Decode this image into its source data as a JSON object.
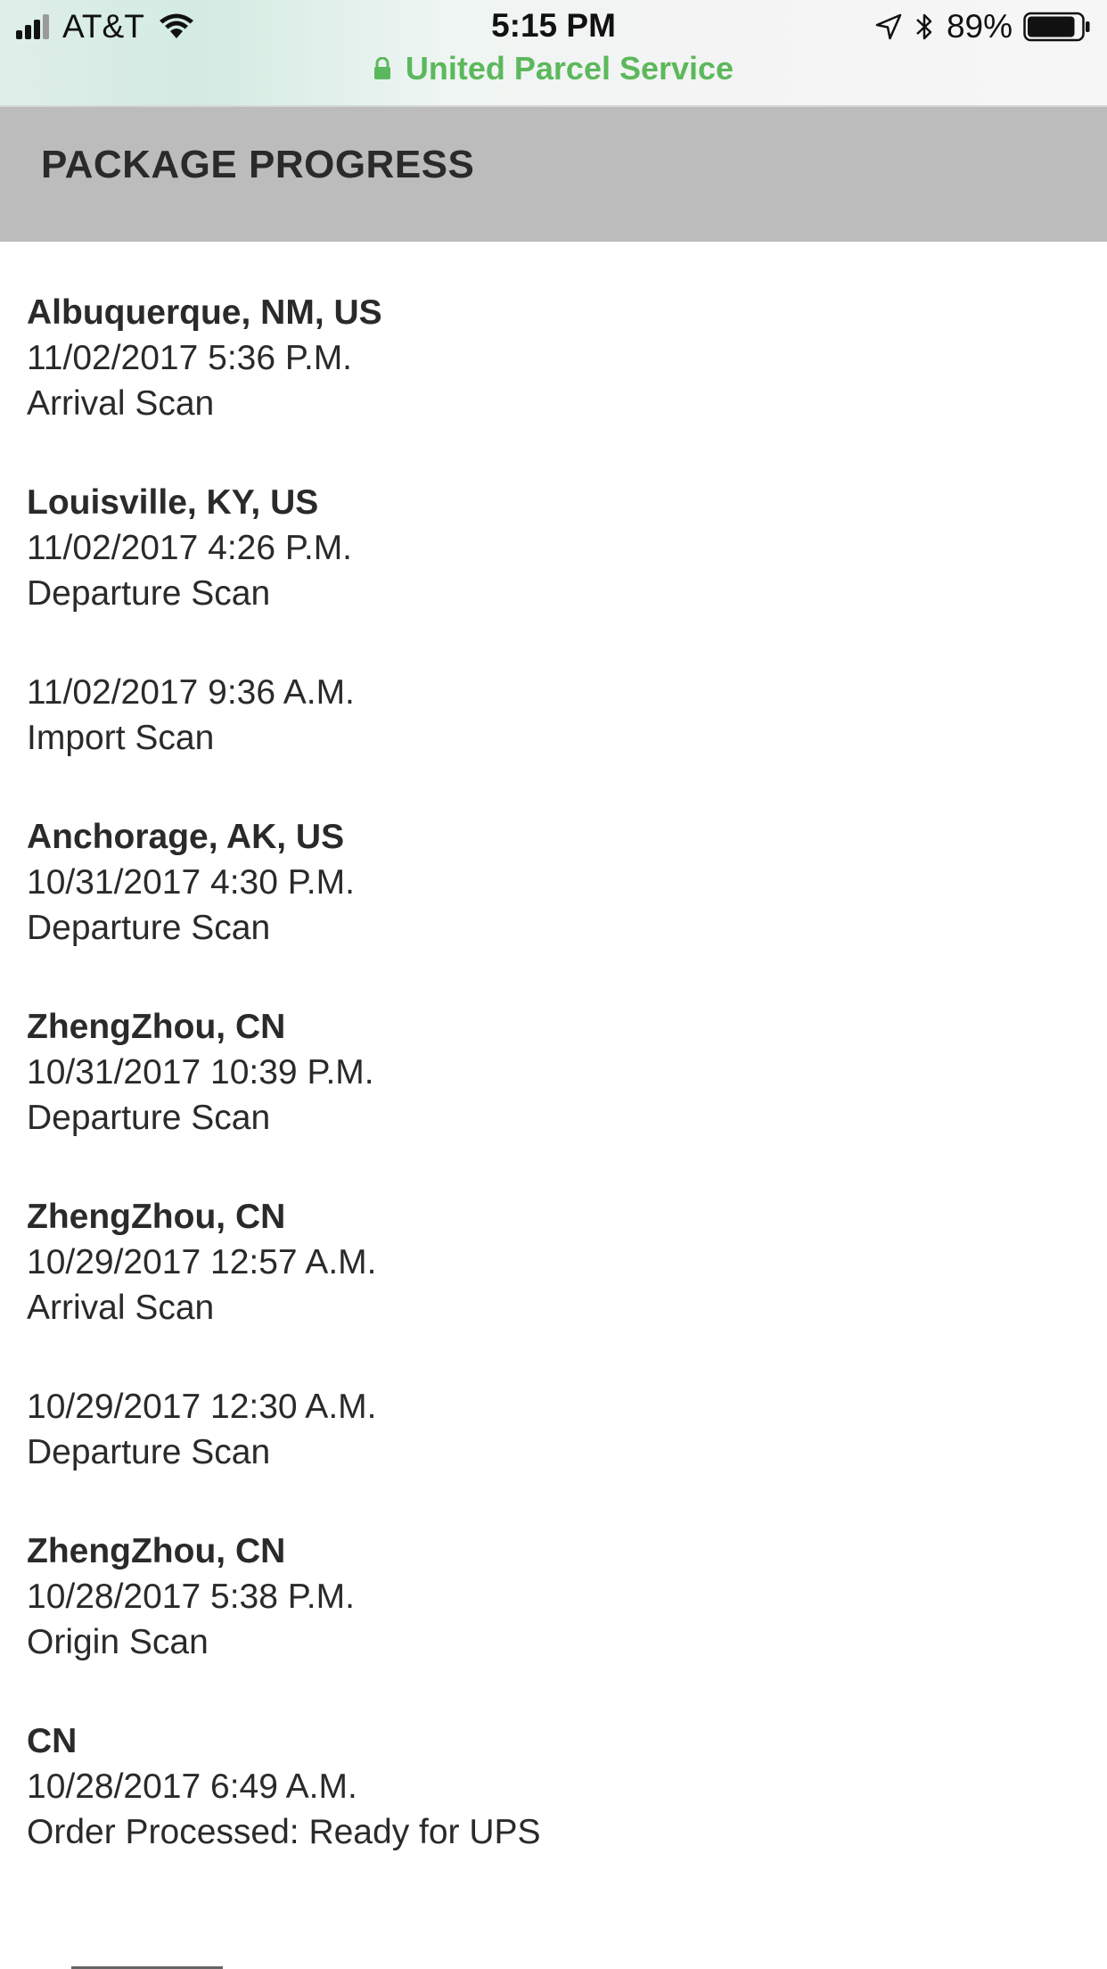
{
  "status_bar": {
    "carrier": "AT&T",
    "time": "5:15 PM",
    "battery": "89%",
    "site_title": "United Parcel Service",
    "signal_bars": 4,
    "signal_bars_filled": 3,
    "battery_level": 0.89,
    "icons": [
      "signal-icon",
      "wifi-icon",
      "lock-icon",
      "location-arrow-icon",
      "bluetooth-icon",
      "battery-icon"
    ],
    "url_color": "#5cb85c"
  },
  "header": {
    "title": "PACKAGE PROGRESS",
    "background_color": "#bcbcbc"
  },
  "progress": [
    {
      "location": "Albuquerque, NM, US",
      "datetime": "11/02/2017 5:36 P.M.",
      "activity": "Arrival Scan"
    },
    {
      "location": "Louisville, KY, US",
      "datetime": "11/02/2017 4:26 P.M.",
      "activity": "Departure Scan"
    },
    {
      "location": "",
      "datetime": "11/02/2017 9:36 A.M.",
      "activity": "Import Scan"
    },
    {
      "location": "Anchorage, AK, US",
      "datetime": "10/31/2017 4:30 P.M.",
      "activity": "Departure Scan"
    },
    {
      "location": "ZhengZhou, CN",
      "datetime": "10/31/2017 10:39 P.M.",
      "activity": "Departure Scan"
    },
    {
      "location": "ZhengZhou, CN",
      "datetime": "10/29/2017 12:57 A.M.",
      "activity": "Arrival Scan"
    },
    {
      "location": "",
      "datetime": "10/29/2017 12:30 A.M.",
      "activity": "Departure Scan"
    },
    {
      "location": "ZhengZhou, CN",
      "datetime": "10/28/2017 5:38 P.M.",
      "activity": "Origin Scan"
    },
    {
      "location": "CN",
      "datetime": "10/28/2017 6:49 A.M.",
      "activity": "Order Processed: Ready for UPS"
    }
  ]
}
